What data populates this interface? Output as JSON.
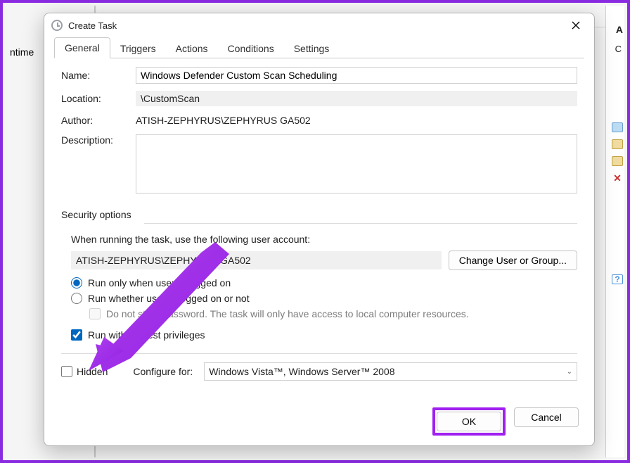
{
  "background": {
    "left_column_text": "ntime",
    "actions_letter": "A",
    "actions_c": "C"
  },
  "dialog": {
    "title": "Create Task",
    "tabs": [
      "General",
      "Triggers",
      "Actions",
      "Conditions",
      "Settings"
    ],
    "active_tab": 0,
    "labels": {
      "name": "Name:",
      "location": "Location:",
      "author": "Author:",
      "description": "Description:",
      "security_options": "Security options",
      "security_sub": "When running the task, use the following user account:",
      "change_user": "Change User or Group...",
      "radio_logged_on": "Run only when user is logged on",
      "radio_logged_or_not": "Run whether user is logged on or not",
      "no_store_pw": "Do not store password.  The task will only have access to local computer resources.",
      "highest_priv": "Run with highest privileges",
      "hidden": "Hidden",
      "configure_for": "Configure for:",
      "ok": "OK",
      "cancel": "Cancel"
    },
    "values": {
      "name": "Windows Defender Custom Scan Scheduling",
      "location": "\\CustomScan",
      "author": "ATISH-ZEPHYRUS\\ZEPHYRUS GA502",
      "description": "",
      "account": "ATISH-ZEPHYRUS\\ZEPHYRUS GA502",
      "configure_for": "Windows Vista™, Windows Server™ 2008",
      "run_only_logged_on": true,
      "run_whether_or_not": false,
      "do_not_store_pw": false,
      "highest_privileges": true,
      "hidden": false
    }
  }
}
